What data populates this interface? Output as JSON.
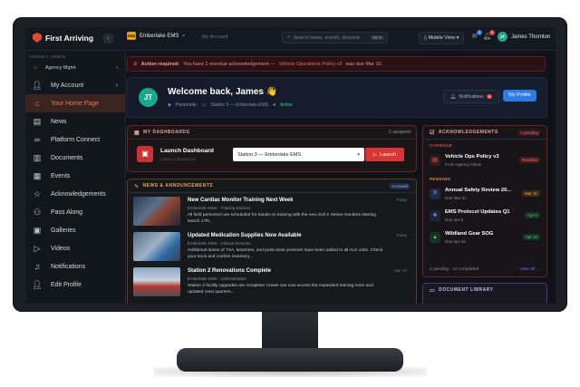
{
  "brand": {
    "name": "First Arriving"
  },
  "topbar": {
    "org": "Emberlake EMS",
    "org_badge": "EMS",
    "account_link": "My Account",
    "search_placeholder": "Search news, events, docume",
    "search_shortcut": "Ctrl K",
    "mobile_view": "Mobile View",
    "notif_count_a": "3",
    "notif_count_b": "4",
    "user_initials": "JT",
    "user_name": "James Thornton"
  },
  "sidebar": {
    "section": "AGENCY ADMIN",
    "agency_mgmt": "Agency Mgmt",
    "items": [
      {
        "label": "My Account"
      },
      {
        "label": "Your Home Page"
      },
      {
        "label": "News"
      },
      {
        "label": "Platform Connect"
      },
      {
        "label": "Documents"
      },
      {
        "label": "Events"
      },
      {
        "label": "Acknowledgements"
      },
      {
        "label": "Pass Along"
      },
      {
        "label": "Galleries"
      },
      {
        "label": "Videos"
      },
      {
        "label": "Notifications"
      },
      {
        "label": "Edit Profile"
      }
    ]
  },
  "alert": {
    "prefix": "Action required:",
    "text": "You have 1 overdue acknowledgement —",
    "link": "Vehicle Operations Policy v3",
    "suffix": "was due Mar 10."
  },
  "welcome": {
    "initials": "JT",
    "title": "Welcome back, James 👋",
    "role": "Paramedic",
    "station": "Station 3 — Emberlake EMS",
    "status": "Active",
    "notifications_label": "Notifications",
    "notifications_count": "5",
    "profile_label": "My Profile"
  },
  "dashboards": {
    "title": "MY DASHBOARDS",
    "count": "2 assigned",
    "launch_title": "Launch Dashboard",
    "launch_sub": "Select a dashboard",
    "selected": "Station 3 — Emberlake EMS",
    "launch_button": "Launch"
  },
  "news": {
    "title": "NEWS & ANNOUNCEMENTS",
    "count": "3 unread",
    "items": [
      {
        "title": "New Cardiac Monitor Training Next Week",
        "source": "Emberlake EMS · Training Division",
        "body": "All field personnel are scheduled for hands-on training with the new Zoll X Series monitors starting March 17th...",
        "date": "Today"
      },
      {
        "title": "Updated Medication Supplies Now Available",
        "source": "Emberlake EMS · Clinical Services",
        "body": "Additional doses of TXA, ketamine, and push-dose pressors have been added to all ALS units. Check your truck and confirm inventory...",
        "date": "Today"
      },
      {
        "title": "Station 2 Renovations Complete",
        "source": "Emberlake EMS · Administration",
        "body": "Station 2 facility upgrades are complete! Crews can now access the expanded training room and updated crew quarters...",
        "date": "Mar 20"
      }
    ]
  },
  "ack": {
    "title": "ACKNOWLEDGEMENTS",
    "count": "4 pending",
    "overdue_label": "OVERDUE",
    "pending_label": "PENDING",
    "overdue": [
      {
        "title": "Vehicle Ops Policy v3",
        "sub": "From Agency Admin",
        "tag": "Overdue"
      }
    ],
    "pending": [
      {
        "title": "Annual Safety Review 20...",
        "sub": "Due Mar 31",
        "tag": "Mar 31"
      },
      {
        "title": "EMS Protocol Updates Q1",
        "sub": "Due Apr 5",
        "tag": "Apr 5"
      },
      {
        "title": "Wildland Gear SOG",
        "sub": "Due Apr 15",
        "tag": "Apr 15"
      }
    ],
    "footer": "4 pending · 12 completed",
    "view_all": "View all →"
  },
  "doclib": {
    "title": "DOCUMENT LIBRARY"
  }
}
